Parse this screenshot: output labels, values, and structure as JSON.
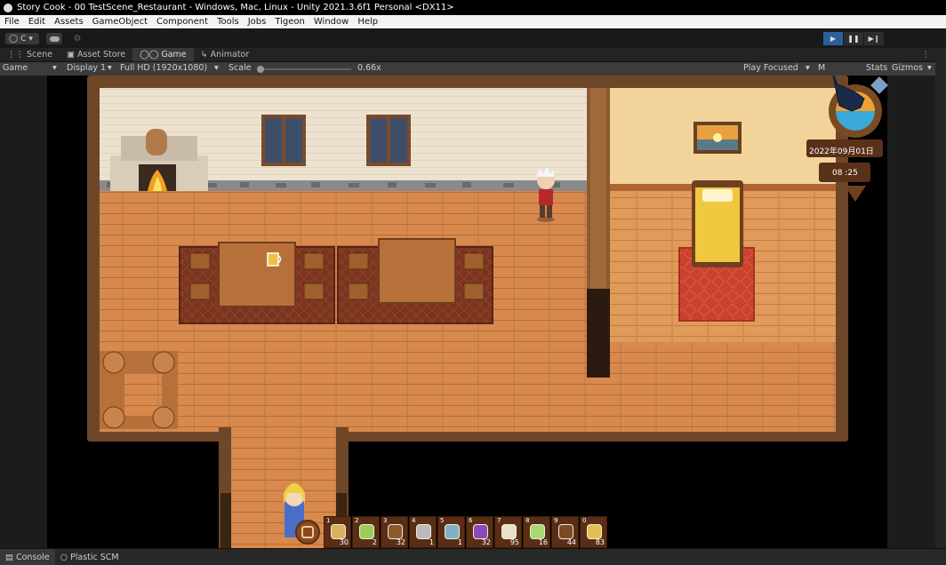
{
  "window": {
    "title": "Story Cook - 00 TestScene_Restaurant - Windows, Mac, Linux - Unity 2021.3.6f1 Personal <DX11>"
  },
  "menu": [
    "File",
    "Edit",
    "Assets",
    "GameObject",
    "Component",
    "Tools",
    "Jobs",
    "Tigeon",
    "Window",
    "Help"
  ],
  "toolbar": {
    "account_label": "C"
  },
  "tabs": [
    {
      "label": "Scene",
      "icon": "grid-icon"
    },
    {
      "label": "Asset Store",
      "icon": "store-icon"
    },
    {
      "label": "Game",
      "icon": "gamepad-icon"
    },
    {
      "label": "Animator",
      "icon": "animator-icon"
    }
  ],
  "game_toolbar": {
    "mode": "Game",
    "display": "Display 1",
    "resolution": "Full HD (1920x1080)",
    "scale_label": "Scale",
    "scale_value": "0.66x",
    "scale_fraction": 0.0,
    "play_focused": "Play Focused",
    "mute_abbrev": "M",
    "stats": "Stats",
    "gizmos": "Gizmos"
  },
  "hud": {
    "date": "2022年09月01日",
    "time": "08 :25"
  },
  "hotbar": [
    {
      "key": "1",
      "count": "30",
      "item": "bread-slice-icon",
      "color": "#d8b060"
    },
    {
      "key": "2",
      "count": "2",
      "item": "green-jar-icon",
      "color": "#9acd5a"
    },
    {
      "key": "3",
      "count": "32",
      "item": "acorn-icon",
      "color": "#8a5a2a"
    },
    {
      "key": "4",
      "count": "1",
      "item": "pickaxe-icon",
      "color": "#bbbbbb"
    },
    {
      "key": "5",
      "count": "1",
      "item": "watering-can-icon",
      "color": "#7fb0c8"
    },
    {
      "key": "6",
      "count": "32",
      "item": "grape-jar-icon",
      "color": "#8a4ab8"
    },
    {
      "key": "7",
      "count": "95",
      "item": "flour-sack-icon",
      "color": "#e8e0c8"
    },
    {
      "key": "8",
      "count": "16",
      "item": "cabbage-jar-icon",
      "color": "#a8d870"
    },
    {
      "key": "9",
      "count": "44",
      "item": "wood-log-icon",
      "color": "#7a4a22"
    },
    {
      "key": "0",
      "count": "83",
      "item": "wheat-icon",
      "color": "#e0c050"
    }
  ],
  "bottom_tabs": [
    {
      "label": "Console",
      "icon": "console-icon"
    },
    {
      "label": "Plastic SCM",
      "icon": "plastic-scm-icon"
    }
  ]
}
